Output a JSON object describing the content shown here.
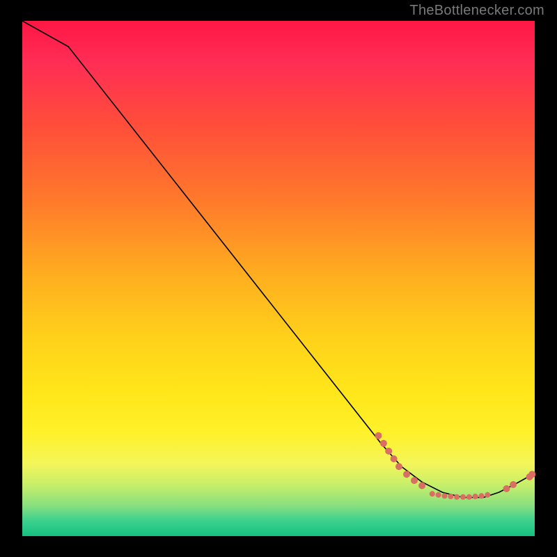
{
  "attribution": "TheBottlenecker.com",
  "chart_data": {
    "type": "line",
    "title": "",
    "xlabel": "",
    "ylabel": "",
    "xlim": [
      0,
      10
    ],
    "ylim": [
      0,
      10
    ],
    "series": [
      {
        "name": "curve",
        "x": [
          0,
          0.9,
          7.0,
          7.4,
          7.8,
          8.2,
          8.6,
          9.0,
          9.3,
          9.6,
          10
        ],
        "y": [
          10.0,
          9.5,
          1.8,
          1.35,
          1.05,
          0.85,
          0.75,
          0.75,
          0.85,
          1.0,
          1.22
        ]
      }
    ],
    "points_cluster_left": [
      {
        "x": 6.95,
        "y": 1.95
      },
      {
        "x": 7.05,
        "y": 1.8
      },
      {
        "x": 7.15,
        "y": 1.65
      },
      {
        "x": 7.25,
        "y": 1.5
      },
      {
        "x": 7.35,
        "y": 1.35
      },
      {
        "x": 7.5,
        "y": 1.2
      },
      {
        "x": 7.65,
        "y": 1.08
      },
      {
        "x": 7.8,
        "y": 0.98
      }
    ],
    "points_bottom_row": [
      {
        "x": 8.0,
        "y": 0.82
      },
      {
        "x": 8.12,
        "y": 0.8
      },
      {
        "x": 8.24,
        "y": 0.78
      },
      {
        "x": 8.36,
        "y": 0.77
      },
      {
        "x": 8.48,
        "y": 0.76
      },
      {
        "x": 8.6,
        "y": 0.76
      },
      {
        "x": 8.72,
        "y": 0.76
      },
      {
        "x": 8.84,
        "y": 0.77
      },
      {
        "x": 8.96,
        "y": 0.78
      },
      {
        "x": 9.08,
        "y": 0.8
      }
    ],
    "points_cluster_right": [
      {
        "x": 9.45,
        "y": 0.92
      },
      {
        "x": 9.58,
        "y": 1.0
      },
      {
        "x": 9.9,
        "y": 1.15
      },
      {
        "x": 9.95,
        "y": 1.2
      }
    ]
  }
}
